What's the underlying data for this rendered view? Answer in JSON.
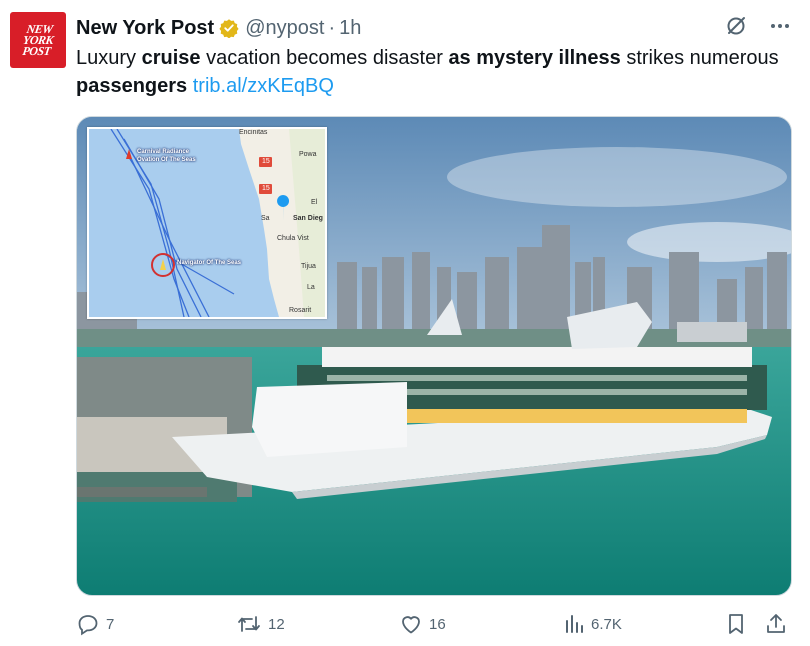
{
  "post": {
    "author_name": "New York Post",
    "handle": "@nypost",
    "separator": "·",
    "time": "1h",
    "avatar_text": "NEW YORK POST",
    "text_segments": [
      {
        "text": "Luxury ",
        "bold": false
      },
      {
        "text": "cruise",
        "bold": true
      },
      {
        "text": " vacation becomes disaster ",
        "bold": false
      },
      {
        "text": "as mystery illness",
        "bold": true
      },
      {
        "text": " strikes numerous ",
        "bold": false
      },
      {
        "text": "passengers",
        "bold": true
      },
      {
        "text": " ",
        "bold": false
      }
    ],
    "link": "trib.al/zxKEqBQ"
  },
  "map": {
    "labels": {
      "encinitas": "Encinitas",
      "poway": "Powa",
      "carnival": "Carnival Radiance",
      "ovation": "Ovation Of The Seas",
      "navigator": "Navigator Of The Seas",
      "san_diego": "San Dieg",
      "el": "El",
      "sa": "Sa",
      "chula_vista": "Chula Vist",
      "tijuana": "Tijua",
      "la": "La",
      "rosarit": "Rosarit",
      "hwy15a": "15",
      "hwy15b": "15"
    }
  },
  "actions": {
    "replies": "7",
    "reposts": "12",
    "likes": "16",
    "views": "6.7K"
  },
  "colors": {
    "accent": "#1d9bf0",
    "secondary_text": "#536471",
    "brand_red": "#d81e28",
    "verified_gold": "#e2b719"
  },
  "icons": [
    "verified-badge-icon",
    "grok-icon",
    "more-icon",
    "reply-icon",
    "repost-icon",
    "like-icon",
    "views-icon",
    "bookmark-icon",
    "share-icon"
  ]
}
